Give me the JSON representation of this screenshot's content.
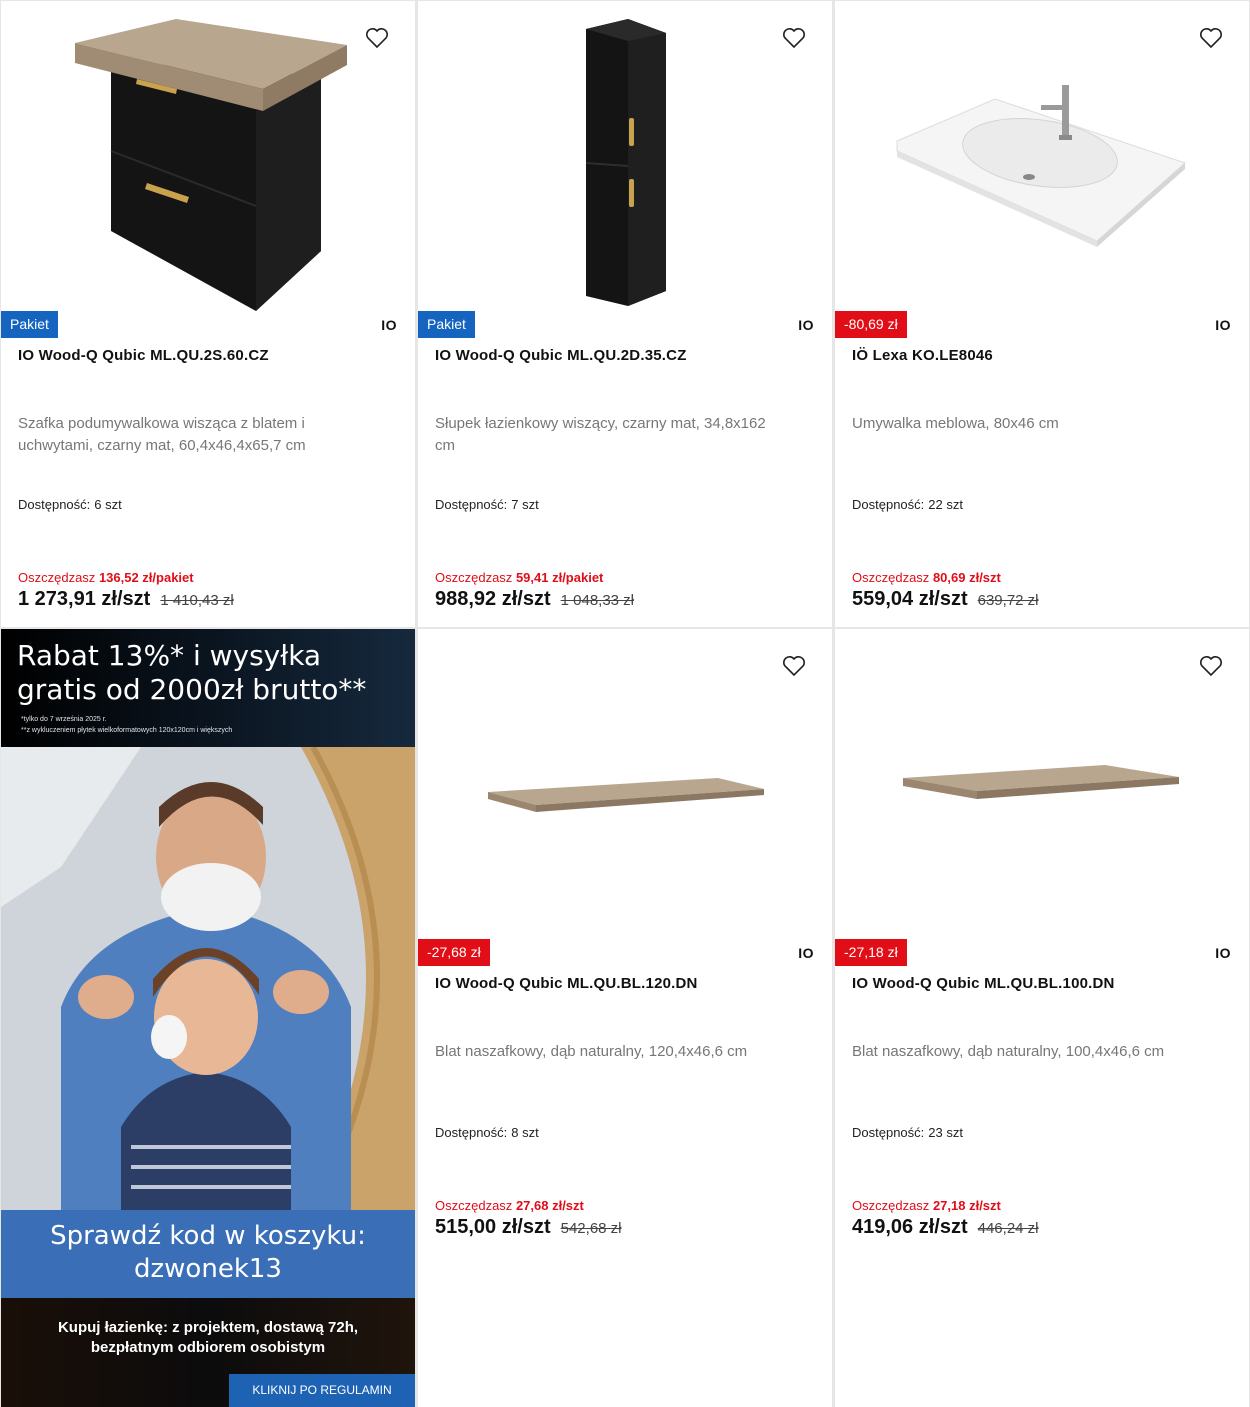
{
  "products": [
    {
      "badge": "Pakiet",
      "badge_type": "pakiet",
      "brand": "IO",
      "title": "IO Wood-Q Qubic ML.QU.2S.60.CZ",
      "description": "Szafka podumywalkowa wisząca z blatem i uchwytami, czarny mat, 60,4x46,4x65,7 cm",
      "availability_label": "Dostępność:",
      "availability_value": "6 szt",
      "save_label": "Oszczędzasz",
      "save_value": "136,52 zł/pakiet",
      "price": "1 273,91 zł/szt",
      "old_price": "1 410,43 zł",
      "image": "cabinet-image"
    },
    {
      "badge": "Pakiet",
      "badge_type": "pakiet",
      "brand": "IO",
      "title": "IO Wood-Q Qubic ML.QU.2D.35.CZ",
      "description": "Słupek łazienkowy wiszący, czarny mat, 34,8x162 cm",
      "availability_label": "Dostępność:",
      "availability_value": "7 szt",
      "save_label": "Oszczędzasz",
      "save_value": "59,41 zł/pakiet",
      "price": "988,92 zł/szt",
      "old_price": "1 048,33 zł",
      "image": "tall-cabinet-image"
    },
    {
      "badge": "-80,69 zł",
      "badge_type": "discount",
      "brand": "IO",
      "title": "IÖ Lexa KO.LE8046",
      "description": "Umywalka meblowa, 80x46 cm",
      "availability_label": "Dostępność:",
      "availability_value": "22 szt",
      "save_label": "Oszczędzasz",
      "save_value": "80,69 zł/szt",
      "price": "559,04 zł/szt",
      "old_price": "639,72 zł",
      "image": "washbasin-image"
    },
    {
      "badge": "-27,68 zł",
      "badge_type": "discount",
      "brand": "IO",
      "title": "IO Wood-Q Qubic ML.QU.BL.120.DN",
      "description": "Blat naszafkowy, dąb naturalny, 120,4x46,6 cm",
      "availability_label": "Dostępność:",
      "availability_value": "8 szt",
      "save_label": "Oszczędzasz",
      "save_value": "27,68 zł/szt",
      "price": "515,00 zł/szt",
      "old_price": "542,68 zł",
      "image": "countertop-image"
    },
    {
      "badge": "-27,18 zł",
      "badge_type": "discount",
      "brand": "IO",
      "title": "IO Wood-Q Qubic ML.QU.BL.100.DN",
      "description": "Blat naszafkowy, dąb naturalny, 100,4x46,6 cm",
      "availability_label": "Dostępność:",
      "availability_value": "23 szt",
      "save_label": "Oszczędzasz",
      "save_value": "27,18 zł/szt",
      "price": "419,06 zł/szt",
      "old_price": "446,24 zł",
      "image": "countertop-image"
    }
  ],
  "banner": {
    "headline_line1": "Rabat 13%* i wysyłka",
    "headline_line2": "gratis od 2000zł brutto**",
    "note1": "*tylko do 7 września 2025 r.",
    "note2": "**z wykluczeniem płytek wielkoformatowych 120x120cm i większych",
    "code_line1": "Sprawdź kod w koszyku:",
    "code_line2": "dzwonek13",
    "buy_line1": "Kupuj łazienkę: z projektem, dostawą 72h,",
    "buy_line2": "bezpłatnym odbiorem osobistym",
    "button": "KLIKNIJ PO REGULAMIN"
  },
  "colors": {
    "pakiet": "#1565c0",
    "discount": "#e10d17"
  }
}
